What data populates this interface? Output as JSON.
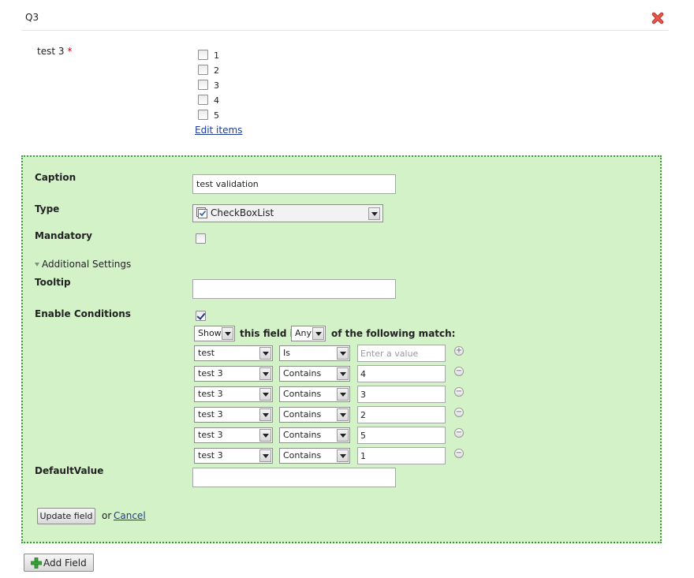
{
  "question": {
    "title": "Q3",
    "field_label": "test 3",
    "required_mark": "*",
    "options": [
      "1",
      "2",
      "3",
      "4",
      "5"
    ],
    "edit_items_label": "Edit items"
  },
  "editor": {
    "caption_label": "Caption",
    "caption_value": "test validation",
    "type_label": "Type",
    "type_value": "CheckBoxList",
    "mandatory_label": "Mandatory",
    "additional_settings_label": "Additional Settings",
    "tooltip_label": "Tooltip",
    "tooltip_value": "",
    "enable_conditions_label": "Enable Conditions",
    "enable_conditions_checked": true,
    "show_select": "Show",
    "this_field_if": "this field if",
    "match_select": "Any",
    "following_match": "of the following match:",
    "conditions": [
      {
        "field": "test",
        "operator": "Is",
        "value": "",
        "placeholder": "Enter a value",
        "action": "+"
      },
      {
        "field": "test 3",
        "operator": "Contains",
        "value": "4",
        "placeholder": "",
        "action": "−"
      },
      {
        "field": "test 3",
        "operator": "Contains",
        "value": "3",
        "placeholder": "",
        "action": "−"
      },
      {
        "field": "test 3",
        "operator": "Contains",
        "value": "2",
        "placeholder": "",
        "action": "−"
      },
      {
        "field": "test 3",
        "operator": "Contains",
        "value": "5",
        "placeholder": "",
        "action": "−"
      },
      {
        "field": "test 3",
        "operator": "Contains",
        "value": "1",
        "placeholder": "",
        "action": "−"
      }
    ],
    "default_value_label": "DefaultValue",
    "default_value": "",
    "update_button": "Update field",
    "or_text": "or",
    "cancel_link": "Cancel"
  },
  "add_field_button": "Add Field",
  "icons": {
    "close": "close-icon",
    "add": "add-icon",
    "checkbox_list": "checkbox-list-icon",
    "expand": "triangle-down-icon"
  },
  "colors": {
    "panel_bg": "#d3f2c8",
    "panel_border": "#3c9a3c",
    "link": "#1f3b9a",
    "required": "#d00000",
    "close_icon": "#d9372f",
    "add_icon": "#36a336"
  }
}
